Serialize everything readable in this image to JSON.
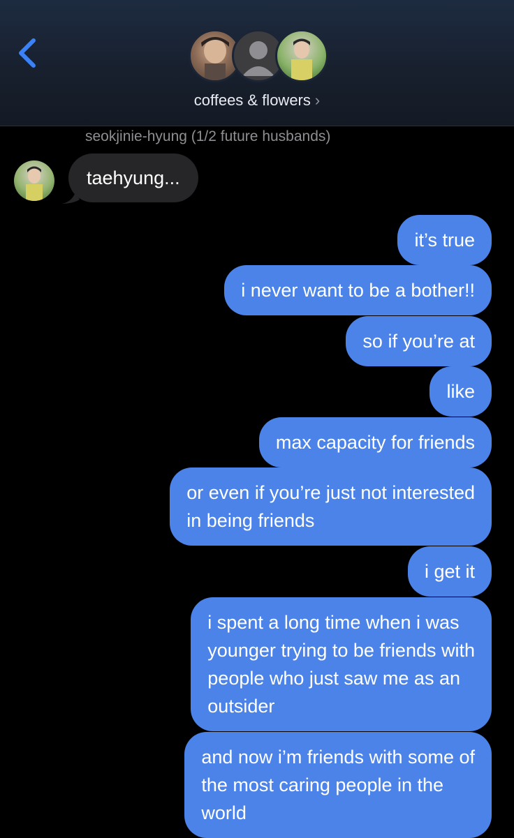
{
  "header": {
    "group_name": "coffees & flowers",
    "chevron": "›",
    "back_icon": "chevron-left-icon",
    "accent": "#3b82f6"
  },
  "incoming": {
    "sender": "seokjinie-hyung (1/2 future husbands)",
    "text": "taehyung..."
  },
  "outgoing": [
    "it’s true",
    "i never want to be a bother!!",
    "so if you’re at",
    "like",
    "max capacity for friends",
    "or even if you’re just not interested\nin being friends",
    "i get it",
    "i spent a long time when i was\nyounger trying to be friends with\npeople who just saw me as an\noutsider",
    "and now i’m friends with some of\nthe most caring people in the\nworld"
  ],
  "colors": {
    "bubble_out": "#4c83e8",
    "bubble_in": "#262628",
    "background": "#000000"
  }
}
